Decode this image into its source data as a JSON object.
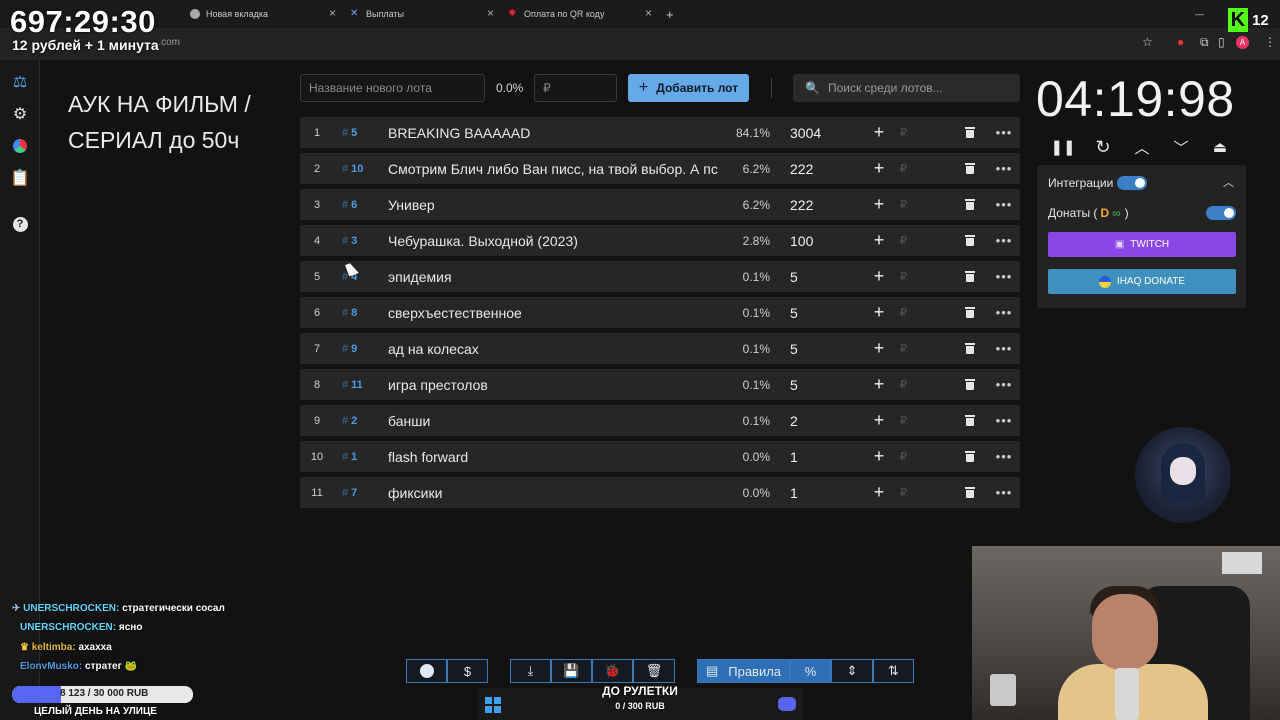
{
  "stream": {
    "uptime": "697:29:30",
    "rate_text": "12 рублей + 1 минута",
    "viewer_count": "12"
  },
  "browser": {
    "tabs": [
      {
        "title": "Новая вкладка",
        "icon": "chrome-icon"
      },
      {
        "title": "Выплаты",
        "icon": "x-icon"
      },
      {
        "title": "Оплата по QR коду",
        "icon": "star-icon"
      }
    ],
    "url": "....com"
  },
  "sidebar": {
    "items": [
      {
        "name": "auction",
        "icon": "gavel-icon"
      },
      {
        "name": "settings",
        "icon": "gear-icon"
      },
      {
        "name": "stats",
        "icon": "pie-chart-icon"
      },
      {
        "name": "history",
        "icon": "clipboard-icon"
      },
      {
        "name": "help",
        "icon": "help-icon"
      }
    ]
  },
  "auction": {
    "title": "АУК НА ФИЛЬМ / СЕРИАЛ до 50ч"
  },
  "toolbar": {
    "new_lot_placeholder": "Название нового лота",
    "percent": "0.0%",
    "amount_placeholder": "₽",
    "add_lot_label": "Добавить лот",
    "search_placeholder": "Поиск среди лотов..."
  },
  "lots": [
    {
      "index": "1",
      "id": "5",
      "name": "BREAKING BAAAAAD",
      "percent": "84.1%",
      "amount": "3004"
    },
    {
      "index": "2",
      "id": "10",
      "name": "Смотрим Блич либо Ван писс, на твой выбор. А пс",
      "percent": "6.2%",
      "amount": "222"
    },
    {
      "index": "3",
      "id": "6",
      "name": "Универ",
      "percent": "6.2%",
      "amount": "222"
    },
    {
      "index": "4",
      "id": "3",
      "name": "Чебурашка. Выходной (2023)",
      "percent": "2.8%",
      "amount": "100"
    },
    {
      "index": "5",
      "id": "4",
      "name": "эпидемия",
      "percent": "0.1%",
      "amount": "5"
    },
    {
      "index": "6",
      "id": "8",
      "name": "сверхъестественное",
      "percent": "0.1%",
      "amount": "5"
    },
    {
      "index": "7",
      "id": "9",
      "name": "ад на колесах",
      "percent": "0.1%",
      "amount": "5"
    },
    {
      "index": "8",
      "id": "11",
      "name": "игра престолов",
      "percent": "0.1%",
      "amount": "5"
    },
    {
      "index": "9",
      "id": "2",
      "name": "банши",
      "percent": "0.1%",
      "amount": "2"
    },
    {
      "index": "10",
      "id": "1",
      "name": "flash forward",
      "percent": "0.0%",
      "amount": "1"
    },
    {
      "index": "11",
      "id": "7",
      "name": "фиксики",
      "percent": "0.0%",
      "amount": "1"
    }
  ],
  "timer": {
    "value": "04:19:98"
  },
  "integrations": {
    "label": "Интеграции",
    "donations_label": "Донаты (",
    "donations_close": ")",
    "twitch_label": "TWITCH",
    "ihaq_label": "IHAQ DONATE"
  },
  "chat": [
    {
      "nick": "UNERSCHROCKEN:",
      "text": "стратегически сосал"
    },
    {
      "nick": "UNERSCHROCKEN:",
      "text": "ясно"
    },
    {
      "nick": "keltimba:",
      "text": "ахахха"
    },
    {
      "nick": "ElonvMusko:",
      "text": "стратег"
    }
  ],
  "donation_goal": {
    "text": "8 123 / 30 000 RUB",
    "progress": 0.27,
    "title": "ЦЕЛЫЙ ДЕНЬ НА УЛИЦЕ"
  },
  "roulette": {
    "title": "ДО РУЛЕТКИ",
    "goal": "0 / 300 RUB"
  },
  "bottom_bar": {
    "rules_label": "Правила",
    "percent_symbol": "%",
    "currency_symbol": "$"
  }
}
